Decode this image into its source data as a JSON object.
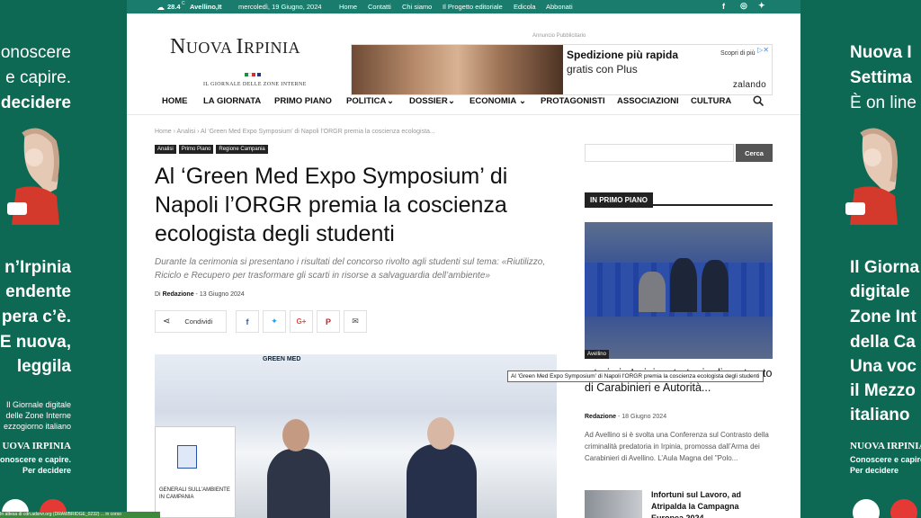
{
  "topbar": {
    "weather_temp": "28.4",
    "weather_unit": "C",
    "city": "Avellino,It",
    "date": "mercoledì, 19 Giugno, 2024",
    "links": [
      "Home",
      "Contatti",
      "Chi siamo",
      "Il Progetto editoriale",
      "Edicola",
      "Abbonati"
    ],
    "social_icons": [
      "facebook-icon",
      "instagram-icon",
      "twitter-icon"
    ]
  },
  "header": {
    "logo_n": "N",
    "logo_uova": "UOVA ",
    "logo_i": "I",
    "logo_rpinia": "RPINIA",
    "tagline": "IL GIORNALE DELLE ZONE INTERNE",
    "flag_colors": [
      "#1a8f3c",
      "#ffffff",
      "#d32f2f",
      "#1e3a8a"
    ]
  },
  "ad": {
    "label": "Annuncio Pubblicitario",
    "headline": "Spedizione più rapida",
    "subline": "gratis con Plus",
    "cta": "Scopri di più",
    "brand": "zalando"
  },
  "nav": {
    "items": [
      "HOME",
      "LA GIORNATA",
      "PRIMO PIANO",
      "POLITICA",
      "DOSSIER",
      "ECONOMIA",
      "PROTAGONISTI",
      "ASSOCIAZIONI",
      "CULTURA"
    ],
    "dropdown_glyph": "⌄"
  },
  "article": {
    "breadcrumb": "Home  ›  Analisi  ›  Al ‘Green Med Expo Symposium’ di Napoli l’ORGR premia la coscienza ecologista...",
    "categories": [
      "Analisi",
      "Primo Piano",
      "Regione Campania"
    ],
    "title": "Al ‘Green Med Expo Symposium’ di Napoli l’ORGR premia la coscienza ecologista degli studenti",
    "subtitle": "Durante la cerimonia si presentano i risultati del concorso rivolto agli studenti sul tema: «Riutilizzo, Riciclo e Recupero per trasformare gli scarti in risorse a salvaguardia dell’ambiente»",
    "by": "Di",
    "author": "Redazione",
    "sep": "-",
    "date": "13 Giugno 2024",
    "share_label": "Condividi",
    "hero_banner": "GREEN MED",
    "hero_card_text": "GENERALI SULL'AMBIENTE IN CAMPANIA",
    "tooltip": "Al 'Green Med Expo Symposium' di Napoli l'ORGR premia la coscienza ecologista degli studenti"
  },
  "sidebar": {
    "search_button": "Cerca",
    "section_title": "IN PRIMO PIANO",
    "main_tag": "Avellino",
    "main_title": "...toria in Irpinia, strategie di contrasto di Carabinieri e Autorità...",
    "main_author": "Redazione",
    "main_sep": "-",
    "main_date": "18 Giugno 2024",
    "main_excerpt": "Ad Avellino si è svolta una Conferenza sul Contrasto della criminalità predatoria in Irpinia, promossa dall’Arma dei Carabinieri di Avellino. L’Aula Magna del \"Polo...",
    "second_title": "Infortuni sul Lavoro, ad Atripalda la Campagna Europea 2024"
  },
  "side_left": {
    "line1": "onoscere",
    "line2": "e capire.",
    "line3": "decidere",
    "big1": "n’Irpinia",
    "big2": "endente",
    "big3": "pera c’è.",
    "big4": "E nuova,",
    "big5": "leggila",
    "small1": "Il Giornale digitale",
    "small2": "delle Zone Interne",
    "small3": "ezzogiorno italiano",
    "brand": "UOVA IRPINIA",
    "brandsub1": "onoscere e capire.",
    "brandsub2": "Per decidere"
  },
  "side_right": {
    "line1": "Nuova I",
    "line2": "Settima",
    "line3": "È on line",
    "big1": "Il Giorna",
    "big2": "digitale",
    "big3": "Zone Int",
    "big4": "della Ca",
    "big5": "Una voc",
    "big6": "il Mezzo",
    "big7": "italiano",
    "brand": "NUOVA IRPINIA",
    "brandsub1": "Conoscere e capire.",
    "brandsub2": "Per decidere"
  },
  "statusbar": {
    "text": "In attesa di cdn.adsrvr.org (DRAWBRIDGE_0232) ... in corso"
  }
}
